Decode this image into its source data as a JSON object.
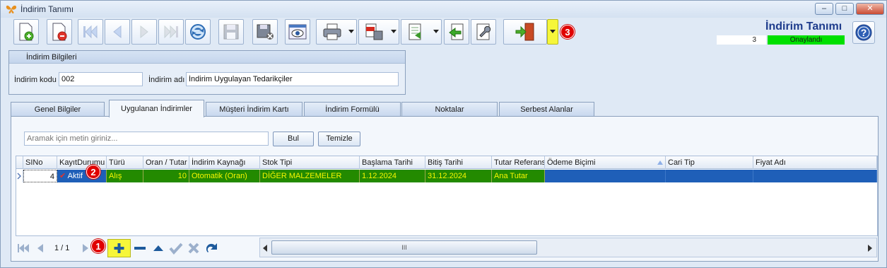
{
  "window": {
    "title": "İndirim Tanımı",
    "minimize": "‒",
    "maximize": "□",
    "close": "✕"
  },
  "header": {
    "title": "İndirim Tanımı",
    "count": "3",
    "status": "Onaylandı"
  },
  "badges": [
    "1",
    "2",
    "3"
  ],
  "group": {
    "title": "İndirim Bilgileri",
    "code_label": "İndirim kodu",
    "code_value": "002",
    "name_label": "İndirim adı",
    "name_value": "İndirim Uygulayan Tedarikçiler"
  },
  "tabs": [
    "Genel Bilgiler",
    "Uygulanan İndirimler",
    "Müşteri İndirim Kartı",
    "İndirim Formülü",
    "Noktalar",
    "Serbest Alanlar"
  ],
  "search": {
    "placeholder": "Aramak için metin giriniz...",
    "find_button": "Bul",
    "clear_button": "Temizle"
  },
  "grid": {
    "columns": [
      "SINo",
      "KayıtDurumu",
      "Türü",
      "Oran / Tutar",
      "İndirim Kaynağı",
      "Stok Tipi",
      "Başlama Tarihi",
      "Bitiş Tarihi",
      "Tutar Referans",
      "Ödeme Biçimi",
      "Cari Tip",
      "Fiyat Adı"
    ],
    "rows": [
      {
        "sino": "4",
        "status": "Aktif",
        "type": "Alış",
        "rate": "10",
        "source": "Otomatik (Oran)",
        "stock_type": "DİĞER MALZEMELER",
        "start": "1.12.2024",
        "end": "31.12.2024",
        "amount_ref": "Ana Tutar",
        "payment": "",
        "account_type": "",
        "price_name": ""
      }
    ]
  },
  "nav": {
    "page": "1 / 1",
    "scroll_label": "III"
  },
  "colors": {
    "accent": "#1e3c8c",
    "row_bg": "#238a00",
    "row_text": "#f6f600",
    "status_green": "#00e000",
    "badge": "#e00000",
    "highlight": "#f6f63a"
  }
}
